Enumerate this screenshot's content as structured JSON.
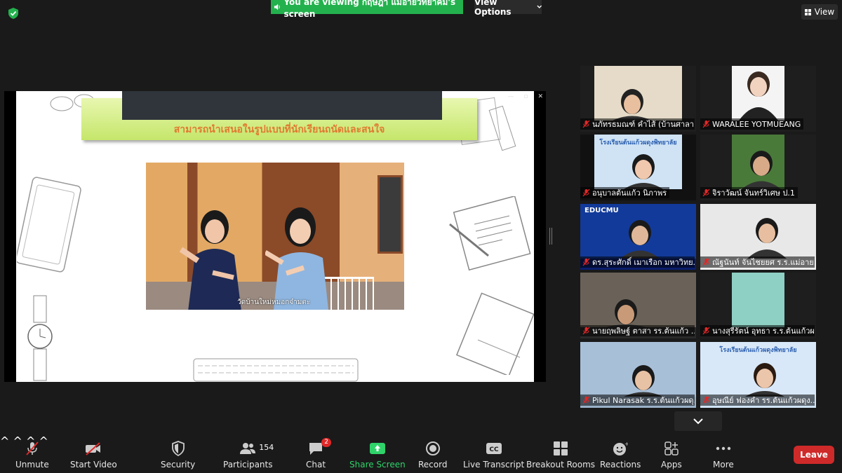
{
  "top_bar": {
    "banner_text": "You are viewing กฤษฎา แม่อายวิทยาคม's screen",
    "view_options_label": "View Options",
    "view_label": "View"
  },
  "slide": {
    "title": "สามารถนำเสนอในรูปแบบที่นักเรียนถนัดและสนใจ",
    "photo_caption": "วัดบ้านใหม่หมอกจ๋ามตะ"
  },
  "participants": [
    {
      "name": "นภัทรธมณฑ์ คำไส้ (บ้านศาลา)"
    },
    {
      "name": "WARALEE YOTMUEANG"
    },
    {
      "name": "อนุบาลต้นแก้ว นิภาพร"
    },
    {
      "name": "จิราวัฒน์ จันทร์วิเศษ ป.1"
    },
    {
      "name": "ดร.สุระศักดิ์ เมาเรือก มหาวิทย..."
    },
    {
      "name": "ณัฐนันท์ จันไชยยศ ร.ร.แม่อาย..."
    },
    {
      "name": "นายฤพลิษฐ์ ตาสา รร.ต้นแก้ว ..."
    },
    {
      "name": "นางสุรีรัตน์ อุทธา ร.ร.ต้นแก้วผ..."
    },
    {
      "name": "Pikul Narasak ร.ร.ต้นแก้วผดุ..."
    },
    {
      "name": "อุษณีย์ ฟองคำ รร.ต้นแก้วผดุง..."
    }
  ],
  "tile_logo_text": "โรงเรียนต้นแก้วผดุงพิทยาลัย",
  "edu_logo_text": "EDUCMU",
  "toolbar": {
    "unmute": "Unmute",
    "start_video": "Start Video",
    "security": "Security",
    "participants": "Participants",
    "participants_count": "154",
    "chat": "Chat",
    "chat_badge": "2",
    "share_screen": "Share Screen",
    "record": "Record",
    "live_transcript": "Live Transcript",
    "breakout_rooms": "Breakout Rooms",
    "reactions": "Reactions",
    "apps": "Apps",
    "more": "More",
    "leave": "Leave"
  },
  "colors": {
    "banner_green": "#23b14d",
    "share_green": "#2fd36a",
    "leave_red": "#cf2a2a",
    "muted_red": "#e02828"
  }
}
